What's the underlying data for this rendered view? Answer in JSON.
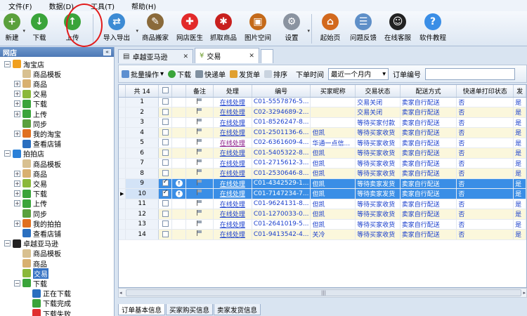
{
  "menu": [
    "文件(F)",
    "数据(D)",
    "工具(T)",
    "帮助(H)"
  ],
  "toolbar": [
    {
      "label": "新建",
      "icon": "new-doc-icon",
      "color": "#5aa03c",
      "glyph": "+"
    },
    {
      "label": "下载",
      "icon": "download-icon",
      "color": "#3aa43a",
      "glyph": "↓"
    },
    {
      "label": "上传",
      "icon": "upload-icon",
      "color": "#3aa43a",
      "glyph": "↑"
    },
    {
      "label": "导入导出",
      "icon": "import-export-icon",
      "color": "#3d8bd4",
      "glyph": "⇄"
    },
    {
      "label": "商品搬家",
      "icon": "move-goods-icon",
      "color": "#8a6a3a",
      "glyph": "✎"
    },
    {
      "label": "网店医生",
      "icon": "shop-doctor-icon",
      "color": "#e22a2a",
      "glyph": "✚"
    },
    {
      "label": "抓取商品",
      "icon": "grab-goods-icon",
      "color": "#c8201e",
      "glyph": "✱"
    },
    {
      "label": "图片空间",
      "icon": "image-space-icon",
      "color": "#c46a1a",
      "glyph": "▣"
    },
    {
      "label": "设置",
      "icon": "settings-icon",
      "color": "#8a93a0",
      "glyph": "⚙"
    },
    {
      "label": "起始页",
      "icon": "home-icon",
      "color": "#d2691e",
      "glyph": "⌂"
    },
    {
      "label": "问题反馈",
      "icon": "feedback-icon",
      "color": "#5e8fc8",
      "glyph": "☰"
    },
    {
      "label": "在线客服",
      "icon": "online-service-icon",
      "color": "#222",
      "glyph": "☺"
    },
    {
      "label": "软件教程",
      "icon": "help-icon",
      "color": "#3a8ee6",
      "glyph": "?"
    }
  ],
  "left": {
    "title": "网店",
    "tree": [
      {
        "label": "淘宝店",
        "level": 0,
        "pm": "-",
        "icon": "taobao-icon",
        "ic": "#f0a020"
      },
      {
        "label": "商品模板",
        "level": 1,
        "pm": "",
        "icon": "template-icon",
        "ic": "#d8c090"
      },
      {
        "label": "商品",
        "level": 1,
        "pm": "+",
        "icon": "goods-icon",
        "ic": "#d8b070"
      },
      {
        "label": "交易",
        "level": 1,
        "pm": "+",
        "icon": "trade-icon",
        "ic": "#8ab83a"
      },
      {
        "label": "下载",
        "level": 1,
        "pm": "+",
        "icon": "download-icon",
        "ic": "#3aa43a"
      },
      {
        "label": "上传",
        "level": 1,
        "pm": "+",
        "icon": "upload-icon",
        "ic": "#3aa43a"
      },
      {
        "label": "同步",
        "level": 1,
        "pm": "",
        "icon": "sync-icon",
        "ic": "#5aa03c"
      },
      {
        "label": "我的淘宝",
        "level": 1,
        "pm": "+",
        "icon": "my-taobao-icon",
        "ic": "#e07020"
      },
      {
        "label": "查看店铺",
        "level": 1,
        "pm": "",
        "icon": "view-shop-icon",
        "ic": "#2a6fc0"
      },
      {
        "label": "拍拍店",
        "level": 0,
        "pm": "-",
        "icon": "paipai-icon",
        "ic": "#2a80d8"
      },
      {
        "label": "商品模板",
        "level": 1,
        "pm": "",
        "icon": "template-icon",
        "ic": "#d8c090"
      },
      {
        "label": "商品",
        "level": 1,
        "pm": "+",
        "icon": "goods-icon",
        "ic": "#d8b070"
      },
      {
        "label": "交易",
        "level": 1,
        "pm": "+",
        "icon": "trade-icon",
        "ic": "#8ab83a"
      },
      {
        "label": "下载",
        "level": 1,
        "pm": "+",
        "icon": "download-icon",
        "ic": "#3aa43a"
      },
      {
        "label": "上传",
        "level": 1,
        "pm": "+",
        "icon": "upload-icon",
        "ic": "#3aa43a"
      },
      {
        "label": "同步",
        "level": 1,
        "pm": "",
        "icon": "sync-icon",
        "ic": "#5aa03c"
      },
      {
        "label": "我的拍拍",
        "level": 1,
        "pm": "+",
        "icon": "my-paipai-icon",
        "ic": "#e07020"
      },
      {
        "label": "查看店铺",
        "level": 1,
        "pm": "",
        "icon": "view-shop-icon",
        "ic": "#2a6fc0"
      },
      {
        "label": "卓越亚马逊",
        "level": 0,
        "pm": "-",
        "icon": "amazon-icon",
        "ic": "#222"
      },
      {
        "label": "商品模板",
        "level": 1,
        "pm": "",
        "icon": "template-icon",
        "ic": "#d8c090"
      },
      {
        "label": "商品",
        "level": 1,
        "pm": "",
        "icon": "goods-icon",
        "ic": "#d8b070"
      },
      {
        "label": "交易",
        "level": 1,
        "pm": "",
        "icon": "trade-icon",
        "ic": "#8ab83a",
        "selected": true
      },
      {
        "label": "下载",
        "level": 1,
        "pm": "-",
        "icon": "download-icon",
        "ic": "#3aa43a"
      },
      {
        "label": "正在下载",
        "level": 2,
        "pm": "",
        "icon": "downloading-icon",
        "ic": "#2a6fc0"
      },
      {
        "label": "下载完成",
        "level": 2,
        "pm": "",
        "icon": "download-done-icon",
        "ic": "#3aa43a"
      },
      {
        "label": "下载失败",
        "level": 2,
        "pm": "",
        "icon": "download-failed-icon",
        "ic": "#e03030"
      }
    ]
  },
  "tabs": [
    {
      "label": "卓越亚马逊",
      "active": false
    },
    {
      "label": "交易",
      "active": true
    }
  ],
  "subbar": {
    "batch": "批量操作",
    "download": "下载",
    "waybill": "快递单",
    "ship_bill": "发货单",
    "sort": "排序",
    "time_label": "下单时间",
    "time_value": "最近一个月内",
    "order_label": "订单编号"
  },
  "grid": {
    "count_label": "共 14",
    "columns": [
      "备注",
      "处理",
      "编号",
      "买家昵称",
      "交易状态",
      "配送方式",
      "快递单打印状态",
      "发"
    ],
    "rows": [
      {
        "n": "1",
        "checked": false,
        "up": false,
        "action": "在线处理",
        "id": "C01-5557876-5...",
        "buyer": "",
        "status": "交易关闭",
        "ship": "卖家自行配送",
        "print": "否",
        "last": "是"
      },
      {
        "n": "2",
        "checked": false,
        "up": false,
        "action": "在线处理",
        "id": "C02-3294689-2...",
        "buyer": "",
        "status": "交易关闭",
        "ship": "卖家自行配送",
        "print": "否",
        "last": "是"
      },
      {
        "n": "3",
        "checked": false,
        "up": false,
        "action": "在线处理",
        "id": "C01-8526247-8...",
        "buyer": "",
        "status": "等待买家付款",
        "ship": "卖家自行配送",
        "print": "否",
        "last": "是"
      },
      {
        "n": "4",
        "checked": false,
        "up": false,
        "action": "在线处理",
        "id": "C01-2501136-6...",
        "buyer": "但凯",
        "status": "等待买家收货",
        "ship": "卖家自行配送",
        "print": "否",
        "last": "是"
      },
      {
        "n": "5",
        "checked": false,
        "up": false,
        "action": "在线处理",
        "id": "C02-6361609-4...",
        "buyer": "华通一点信...",
        "status": "等待买家收货",
        "ship": "卖家自行配送",
        "print": "否",
        "last": "是",
        "visited": true
      },
      {
        "n": "6",
        "checked": false,
        "up": false,
        "action": "在线处理",
        "id": "C01-5405322-8...",
        "buyer": "但凯",
        "status": "等待买家收货",
        "ship": "卖家自行配送",
        "print": "否",
        "last": "是"
      },
      {
        "n": "7",
        "checked": false,
        "up": false,
        "action": "在线处理",
        "id": "C01-2715612-3...",
        "buyer": "但凯",
        "status": "等待买家收货",
        "ship": "卖家自行配送",
        "print": "否",
        "last": "是"
      },
      {
        "n": "8",
        "checked": false,
        "up": false,
        "action": "在线处理",
        "id": "C01-2530646-8...",
        "buyer": "但凯",
        "status": "等待买家收货",
        "ship": "卖家自行配送",
        "print": "否",
        "last": "是"
      },
      {
        "n": "9",
        "checked": true,
        "up": true,
        "action": "在线处理",
        "id": "C01-4342529-1...",
        "buyer": "但凯",
        "status": "等待卖家发货",
        "ship": "卖家自行配送",
        "print": "否",
        "last": "是",
        "selected": true
      },
      {
        "n": "10",
        "checked": true,
        "up": true,
        "action": "在线处理",
        "id": "C01-7147234-7...",
        "buyer": "但凯",
        "status": "等待卖家发货",
        "ship": "卖家自行配送",
        "print": "否",
        "last": "是",
        "selected": true,
        "current": true
      },
      {
        "n": "11",
        "checked": false,
        "up": false,
        "action": "在线处理",
        "id": "C01-9624131-8...",
        "buyer": "但凯",
        "status": "等待买家收货",
        "ship": "卖家自行配送",
        "print": "否",
        "last": "是"
      },
      {
        "n": "12",
        "checked": false,
        "up": false,
        "action": "在线处理",
        "id": "C01-1270033-0...",
        "buyer": "但凯",
        "status": "等待买家收货",
        "ship": "卖家自行配送",
        "print": "否",
        "last": "是"
      },
      {
        "n": "13",
        "checked": false,
        "up": false,
        "action": "在线处理",
        "id": "C01-2641019-5...",
        "buyer": "但凯",
        "status": "等待买家收货",
        "ship": "卖家自行配送",
        "print": "否",
        "last": "是"
      },
      {
        "n": "14",
        "checked": false,
        "up": false,
        "action": "在线处理",
        "id": "C01-9413542-4...",
        "buyer": "关冷",
        "status": "等待买家收货",
        "ship": "卖家自行配送",
        "print": "否",
        "last": "是"
      }
    ]
  },
  "bottom_tabs": [
    "订单基本信息",
    "买家购买信息",
    "卖家发货信息"
  ],
  "scroll_grip": "|||"
}
